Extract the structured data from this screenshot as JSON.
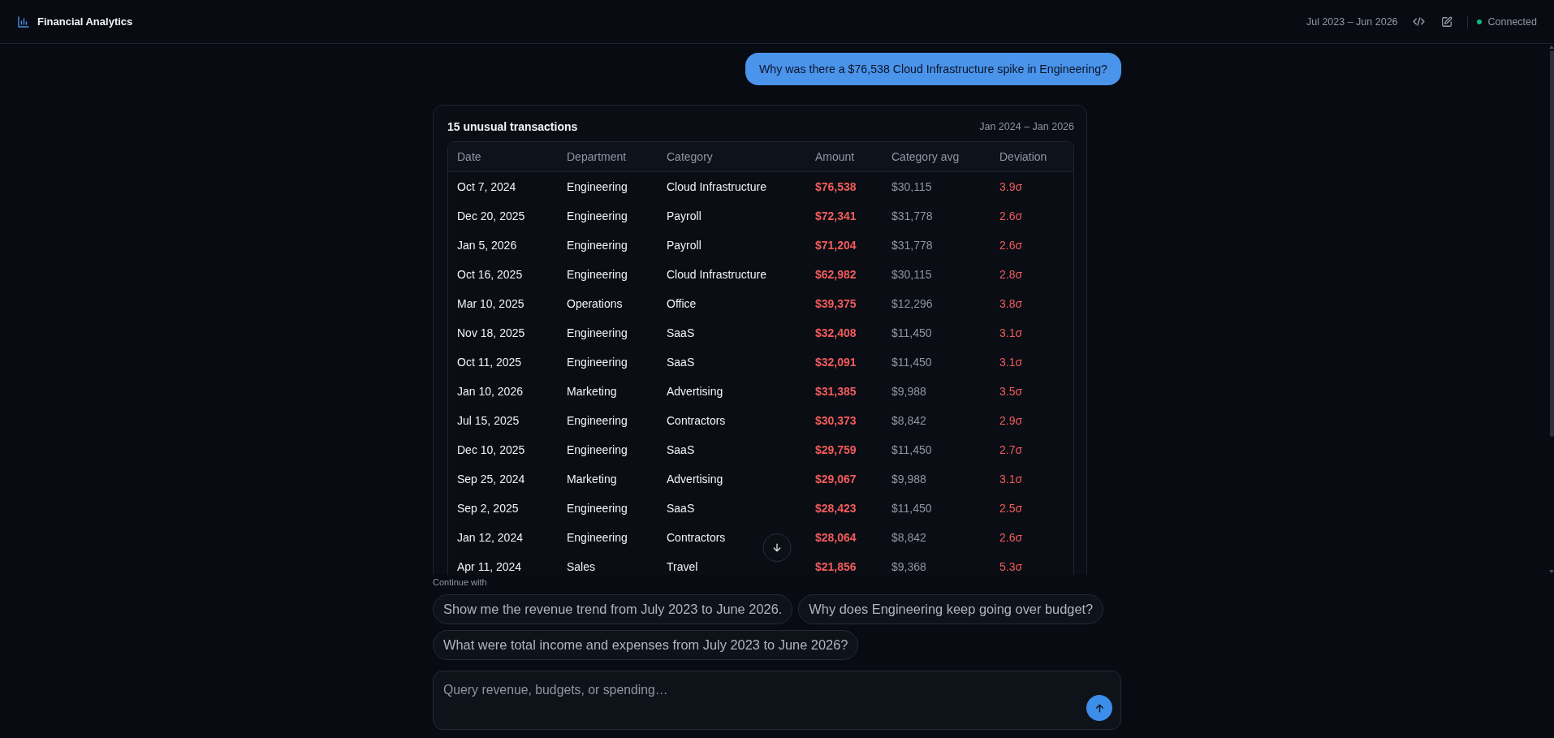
{
  "header": {
    "title": "Financial Analytics",
    "date_range": "Jul 2023 – Jun 2026",
    "status": {
      "label": "Connected",
      "connected": true
    }
  },
  "user_message": {
    "text": "Why was there a $76,538 Cloud Infrastructure spike in Engineering?"
  },
  "result_card": {
    "title": "15 unusual transactions",
    "range": "Jan 2024 – Jan 2026",
    "columns": [
      {
        "label": "Date",
        "kind": "plain"
      },
      {
        "label": "Department",
        "kind": "plain"
      },
      {
        "label": "Category",
        "kind": "plain"
      },
      {
        "label": "Amount",
        "kind": "alert_amount"
      },
      {
        "label": "Category avg",
        "kind": "muted"
      },
      {
        "label": "Deviation",
        "kind": "alert"
      }
    ],
    "rows": [
      [
        "Oct 7, 2024",
        "Engineering",
        "Cloud Infrastructure",
        "$76,538",
        "$30,115",
        "3.9σ"
      ],
      [
        "Dec 20, 2025",
        "Engineering",
        "Payroll",
        "$72,341",
        "$31,778",
        "2.6σ"
      ],
      [
        "Jan 5, 2026",
        "Engineering",
        "Payroll",
        "$71,204",
        "$31,778",
        "2.6σ"
      ],
      [
        "Oct 16, 2025",
        "Engineering",
        "Cloud Infrastructure",
        "$62,982",
        "$30,115",
        "2.8σ"
      ],
      [
        "Mar 10, 2025",
        "Operations",
        "Office",
        "$39,375",
        "$12,296",
        "3.8σ"
      ],
      [
        "Nov 18, 2025",
        "Engineering",
        "SaaS",
        "$32,408",
        "$11,450",
        "3.1σ"
      ],
      [
        "Oct 11, 2025",
        "Engineering",
        "SaaS",
        "$32,091",
        "$11,450",
        "3.1σ"
      ],
      [
        "Jan 10, 2026",
        "Marketing",
        "Advertising",
        "$31,385",
        "$9,988",
        "3.5σ"
      ],
      [
        "Jul 15, 2025",
        "Engineering",
        "Contractors",
        "$30,373",
        "$8,842",
        "2.9σ"
      ],
      [
        "Dec 10, 2025",
        "Engineering",
        "SaaS",
        "$29,759",
        "$11,450",
        "2.7σ"
      ],
      [
        "Sep 25, 2024",
        "Marketing",
        "Advertising",
        "$29,067",
        "$9,988",
        "3.1σ"
      ],
      [
        "Sep 2, 2025",
        "Engineering",
        "SaaS",
        "$28,423",
        "$11,450",
        "2.5σ"
      ],
      [
        "Jan 12, 2024",
        "Engineering",
        "Contractors",
        "$28,064",
        "$8,842",
        "2.6σ"
      ],
      [
        "Apr 11, 2024",
        "Sales",
        "Travel",
        "$21,856",
        "$9,368",
        "5.3σ"
      ]
    ]
  },
  "suggestions": {
    "label": "Continue with",
    "items": [
      "Show me the revenue trend from July 2023 to June 2026.",
      "Why does Engineering keep going over budget?",
      "What were total income and expenses from July 2023 to June 2026?"
    ]
  },
  "composer": {
    "placeholder": "Query revenue, budgets, or spending…"
  }
}
